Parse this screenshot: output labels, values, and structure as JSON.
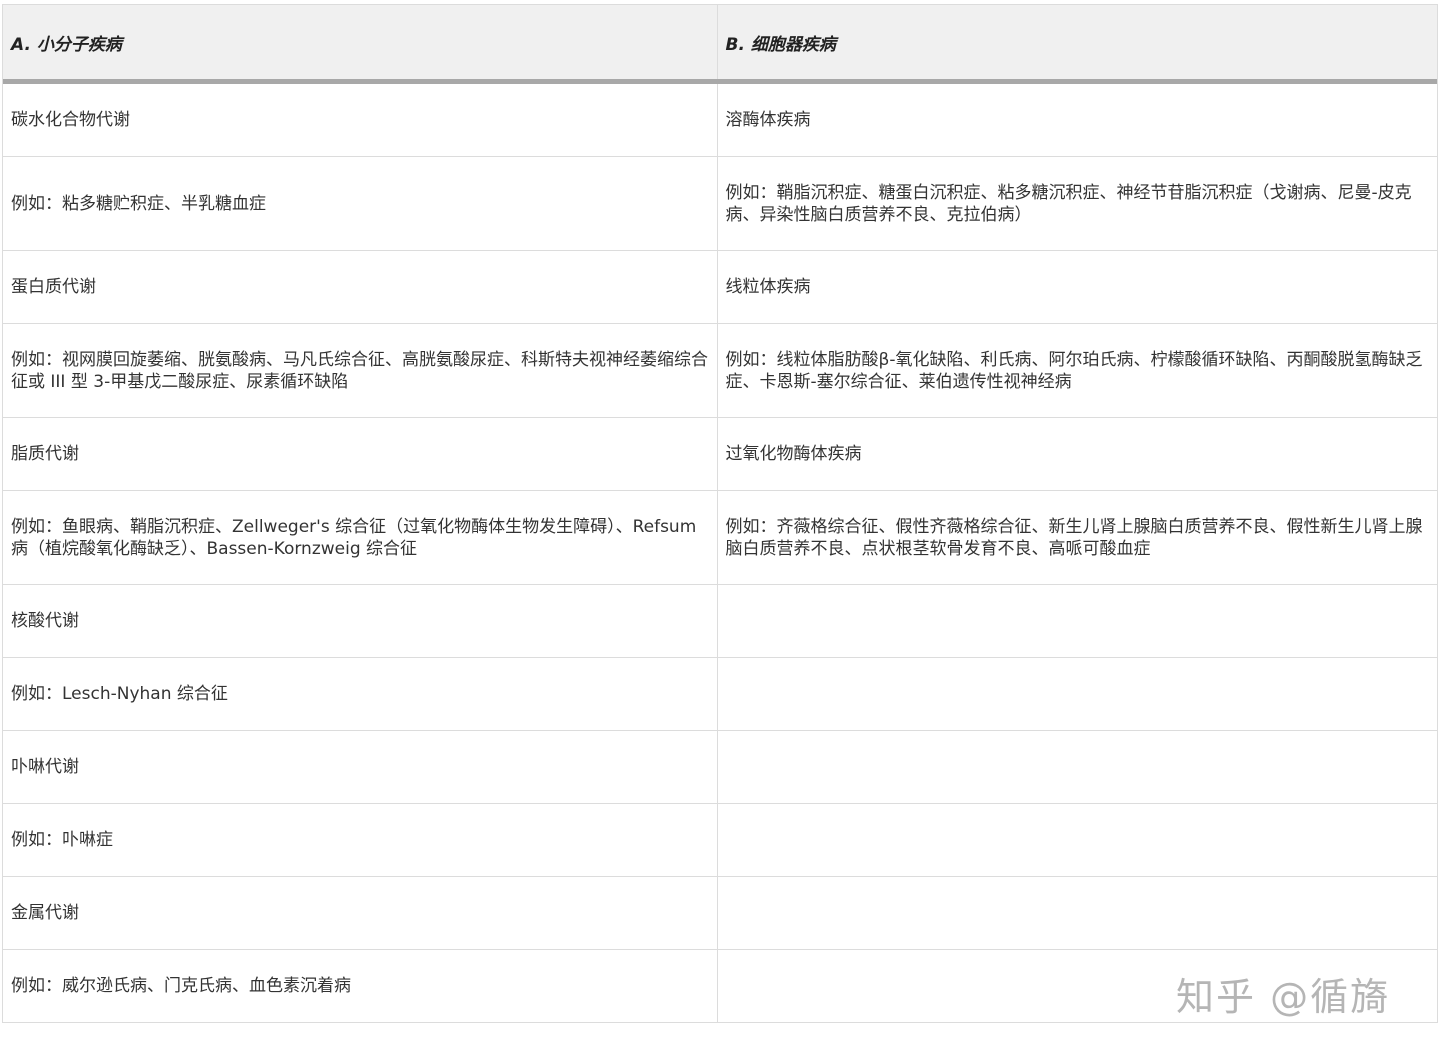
{
  "table": {
    "headers": [
      "A. 小分子疾病",
      "B. 细胞器疾病"
    ],
    "rows": [
      {
        "a": "碳水化合物代谢",
        "b": "溶酶体疾病"
      },
      {
        "a": "例如：粘多糖贮积症、半乳糖血症",
        "b": "例如：鞘脂沉积症、糖蛋白沉积症、粘多糖沉积症、神经节苷脂沉积症（戈谢病、尼曼-皮克病、异染性脑白质营养不良、克拉伯病）"
      },
      {
        "a": "蛋白质代谢",
        "b": "线粒体疾病"
      },
      {
        "a": "例如：视网膜回旋萎缩、胱氨酸病、马凡氏综合征、高胱氨酸尿症、科斯特夫视神经萎缩综合征或 III 型 3-甲基戊二酸尿症、尿素循环缺陷",
        "b": "例如：线粒体脂肪酸β-氧化缺陷、利氏病、阿尔珀氏病、柠檬酸循环缺陷、丙酮酸脱氢酶缺乏症、卡恩斯-塞尔综合征、莱伯遗传性视神经病"
      },
      {
        "a": "脂质代谢",
        "b": "过氧化物酶体疾病"
      },
      {
        "a": "例如：鱼眼病、鞘脂沉积症、Zellweger's 综合征（过氧化物酶体生物发生障碍）、Refsum 病（植烷酸氧化酶缺乏）、Bassen-Kornzweig 综合征",
        "b": "例如：齐薇格综合征、假性齐薇格综合征、新生儿肾上腺脑白质营养不良、假性新生儿肾上腺脑白质营养不良、点状根茎软骨发育不良、高哌可酸血症"
      },
      {
        "a": "核酸代谢",
        "b": ""
      },
      {
        "a": "例如：Lesch-Nyhan 综合征",
        "b": ""
      },
      {
        "a": "卟啉代谢",
        "b": ""
      },
      {
        "a": "例如：卟啉症",
        "b": ""
      },
      {
        "a": "金属代谢",
        "b": ""
      },
      {
        "a": "例如：威尔逊氏病、门克氏病、血色素沉着病",
        "b": ""
      }
    ]
  },
  "watermark": "知乎 @循旖"
}
